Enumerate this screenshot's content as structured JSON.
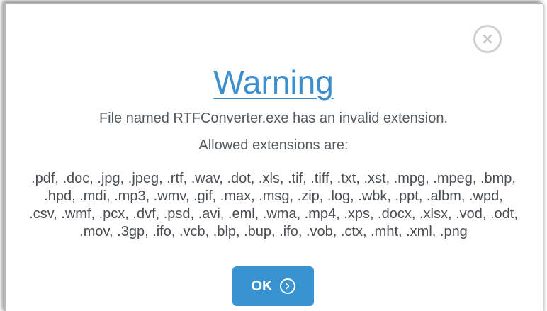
{
  "dialog": {
    "title": "Warning",
    "message": "File named RTFConverter.exe has an invalid extension.",
    "allowed_label": "Allowed extensions are:",
    "extensions_text": ".pdf, .doc, .jpg, .jpeg, .rtf, .wav, .dot, .xls, .tif, .tiff, .txt, .xst, .mpg, .mpeg, .bmp, .hpd, .mdi, .mp3, .wmv, .gif, .max, .msg, .zip, .log, .wbk, .ppt, .albm, .wpd, .csv, .wmf, .pcx, .dvf, .psd, .avi, .eml, .wma, .mp4, .xps, .docx, .xlsx, .vod, .odt, .mov, .3gp, .ifo, .vcb, .blp, .bup, .ifo, .vob, .ctx, .mht, .xml, .png",
    "ok_label": "OK",
    "close_icon": "close-icon",
    "ok_icon": "chevron-right-circle-icon"
  },
  "colors": {
    "accent": "#3a93d1",
    "title": "#3b8fce",
    "text": "#555a5f",
    "close_border": "#d0d0d0"
  }
}
